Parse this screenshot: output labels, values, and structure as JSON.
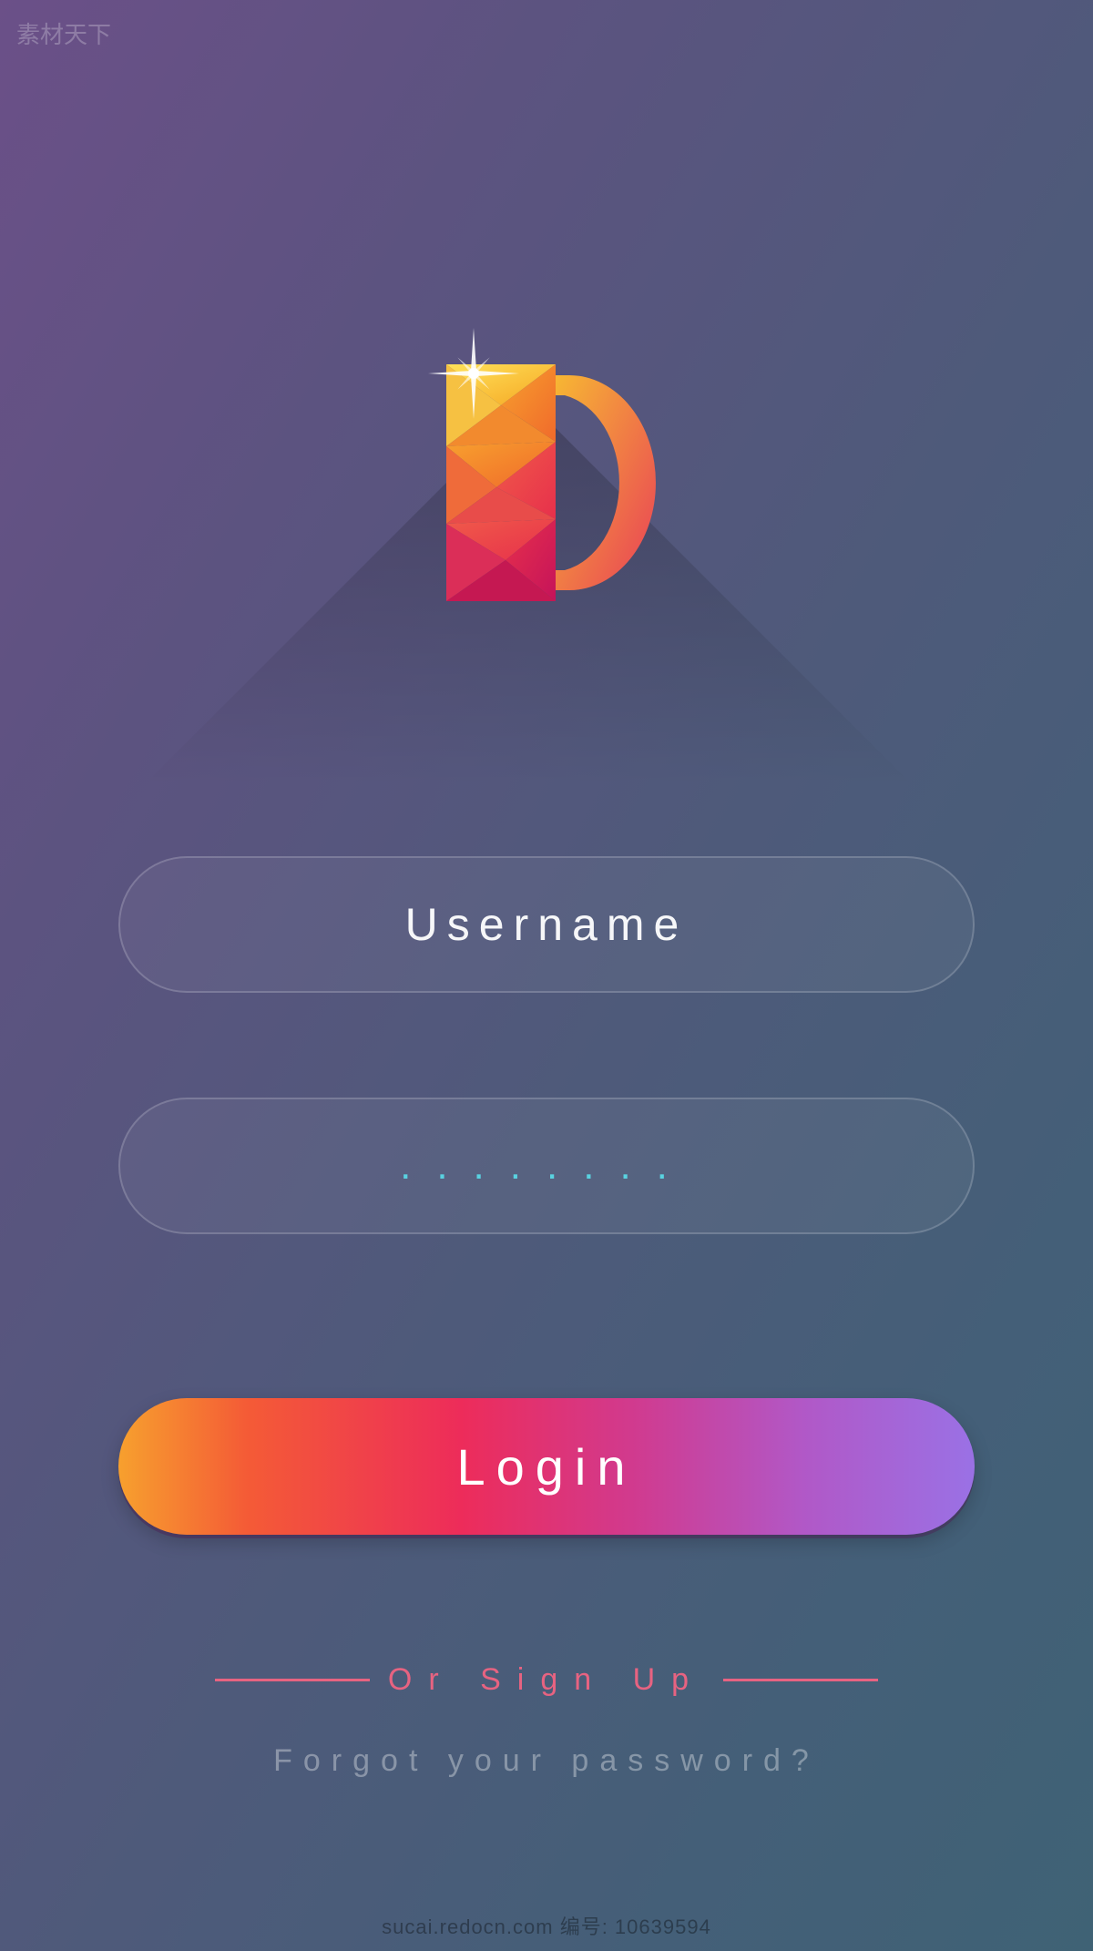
{
  "logo": {
    "letter": "D"
  },
  "form": {
    "username": {
      "placeholder": "Username",
      "value": ""
    },
    "password": {
      "placeholder": "........",
      "value": ""
    },
    "login_label": "Login"
  },
  "links": {
    "signup": "Or Sign Up",
    "forgot": "Forgot your password?"
  },
  "watermark": {
    "top": "素材天下",
    "bottom": "sucai.redocn.com 编号: 10639594"
  }
}
